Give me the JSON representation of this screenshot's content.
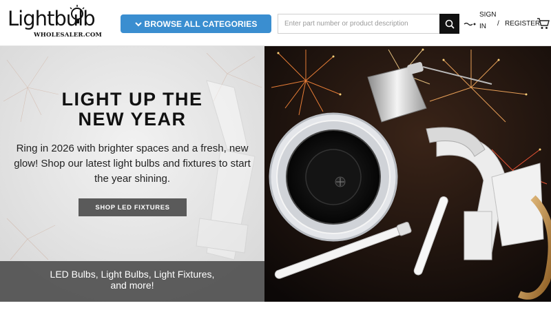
{
  "header": {
    "logo_word": "Lightbulb",
    "logo_sub": "WHOLESALER.COM",
    "browse_label": "BROWSE ALL CATEGORIES",
    "search_placeholder": "Enter part number or product description",
    "sign_in_line1": "SIGN",
    "sign_in_line2": "IN",
    "separator": "/",
    "register_label": "REGISTER",
    "icons": [
      "chevron-down-icon",
      "search-icon",
      "flag-icon",
      "cart-icon",
      "bulb-icon"
    ],
    "colors": {
      "accent": "#3a8ed0",
      "search_button": "#111111"
    }
  },
  "hero": {
    "title_line1": "LIGHT UP THE",
    "title_line2": "NEW YEAR",
    "subtitle": "Ring in 2026 with brighter spaces and a fresh, new glow! Shop our latest light bulbs and fixtures to start the year shining.",
    "cta_label": "SHOP LED FIXTURES",
    "band_text": "LED Bulbs, Light Bulbs, Light Fixtures, and more!",
    "colors": {
      "cta_bg": "#5a5a5a",
      "band_bg": "#505050",
      "right_bg": "#120c0a"
    }
  }
}
